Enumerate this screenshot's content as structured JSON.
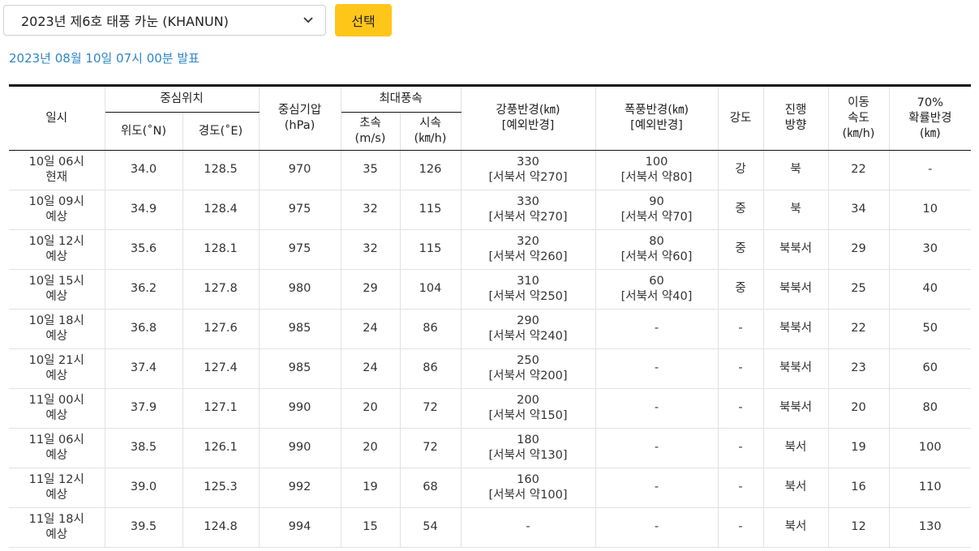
{
  "typhoon_select": {
    "selected": "2023년 제6호 태풍 카눈 (KHANUN)",
    "icon": "chevron-down-icon"
  },
  "select_button_label": "선택",
  "issued_text": "2023년 08월 10일 07시 00분 발표",
  "colors": {
    "accent_button": "#ffc61a",
    "issued_text": "#2f86c6"
  },
  "table": {
    "headers": {
      "datetime": "일시",
      "center_position": "중심위치",
      "lat": "위도(˚N)",
      "lon": "경도(˚E)",
      "pressure_line1": "중심기압",
      "pressure_line2": "(hPa)",
      "max_wind": "최대풍속",
      "wind_ms_line1": "초속",
      "wind_ms_line2": "(m/s)",
      "wind_kmh_line1": "시속",
      "wind_kmh_line2": "(㎞/h)",
      "gale_line1": "강풍반경(㎞)",
      "gale_line2": "[예외반경]",
      "storm_line1": "폭풍반경(㎞)",
      "storm_line2": "[예외반경]",
      "intensity": "강도",
      "direction_line1": "진행",
      "direction_line2": "방향",
      "speed_line1": "이동",
      "speed_line2": "속도",
      "speed_line3": "(㎞/h)",
      "prob_line1": "70%",
      "prob_line2": "확률반경",
      "prob_line3": "(㎞)"
    },
    "rows": [
      {
        "time": "10일 06시",
        "status": "현재",
        "lat": "34.0",
        "lon": "128.5",
        "pressure": "970",
        "wind_ms": "35",
        "wind_kmh": "126",
        "gale": "330",
        "gale_ex": "[서북서 약270]",
        "storm": "100",
        "storm_ex": "[서북서 약80]",
        "intensity": "강",
        "direction": "북",
        "speed": "22",
        "prob": "-"
      },
      {
        "time": "10일 09시",
        "status": "예상",
        "lat": "34.9",
        "lon": "128.4",
        "pressure": "975",
        "wind_ms": "32",
        "wind_kmh": "115",
        "gale": "330",
        "gale_ex": "[서북서 약270]",
        "storm": "90",
        "storm_ex": "[서북서 약70]",
        "intensity": "중",
        "direction": "북",
        "speed": "34",
        "prob": "10"
      },
      {
        "time": "10일 12시",
        "status": "예상",
        "lat": "35.6",
        "lon": "128.1",
        "pressure": "975",
        "wind_ms": "32",
        "wind_kmh": "115",
        "gale": "320",
        "gale_ex": "[서북서 약260]",
        "storm": "80",
        "storm_ex": "[서북서 약60]",
        "intensity": "중",
        "direction": "북북서",
        "speed": "29",
        "prob": "30"
      },
      {
        "time": "10일 15시",
        "status": "예상",
        "lat": "36.2",
        "lon": "127.8",
        "pressure": "980",
        "wind_ms": "29",
        "wind_kmh": "104",
        "gale": "310",
        "gale_ex": "[서북서 약250]",
        "storm": "60",
        "storm_ex": "[서북서 약40]",
        "intensity": "중",
        "direction": "북북서",
        "speed": "25",
        "prob": "40"
      },
      {
        "time": "10일 18시",
        "status": "예상",
        "lat": "36.8",
        "lon": "127.6",
        "pressure": "985",
        "wind_ms": "24",
        "wind_kmh": "86",
        "gale": "290",
        "gale_ex": "[서북서 약240]",
        "storm": "-",
        "storm_ex": "",
        "intensity": "-",
        "direction": "북북서",
        "speed": "22",
        "prob": "50"
      },
      {
        "time": "10일 21시",
        "status": "예상",
        "lat": "37.4",
        "lon": "127.4",
        "pressure": "985",
        "wind_ms": "24",
        "wind_kmh": "86",
        "gale": "250",
        "gale_ex": "[서북서 약200]",
        "storm": "-",
        "storm_ex": "",
        "intensity": "-",
        "direction": "북북서",
        "speed": "23",
        "prob": "60"
      },
      {
        "time": "11일 00시",
        "status": "예상",
        "lat": "37.9",
        "lon": "127.1",
        "pressure": "990",
        "wind_ms": "20",
        "wind_kmh": "72",
        "gale": "200",
        "gale_ex": "[서북서 약150]",
        "storm": "-",
        "storm_ex": "",
        "intensity": "-",
        "direction": "북북서",
        "speed": "20",
        "prob": "80"
      },
      {
        "time": "11일 06시",
        "status": "예상",
        "lat": "38.5",
        "lon": "126.1",
        "pressure": "990",
        "wind_ms": "20",
        "wind_kmh": "72",
        "gale": "180",
        "gale_ex": "[서북서 약130]",
        "storm": "-",
        "storm_ex": "",
        "intensity": "-",
        "direction": "북서",
        "speed": "19",
        "prob": "100"
      },
      {
        "time": "11일 12시",
        "status": "예상",
        "lat": "39.0",
        "lon": "125.3",
        "pressure": "992",
        "wind_ms": "19",
        "wind_kmh": "68",
        "gale": "160",
        "gale_ex": "[서북서 약100]",
        "storm": "-",
        "storm_ex": "",
        "intensity": "-",
        "direction": "북서",
        "speed": "16",
        "prob": "110"
      },
      {
        "time": "11일 18시",
        "status": "예상",
        "lat": "39.5",
        "lon": "124.8",
        "pressure": "994",
        "wind_ms": "15",
        "wind_kmh": "54",
        "gale": "-",
        "gale_ex": "",
        "storm": "-",
        "storm_ex": "",
        "intensity": "-",
        "direction": "북서",
        "speed": "12",
        "prob": "130"
      }
    ]
  }
}
